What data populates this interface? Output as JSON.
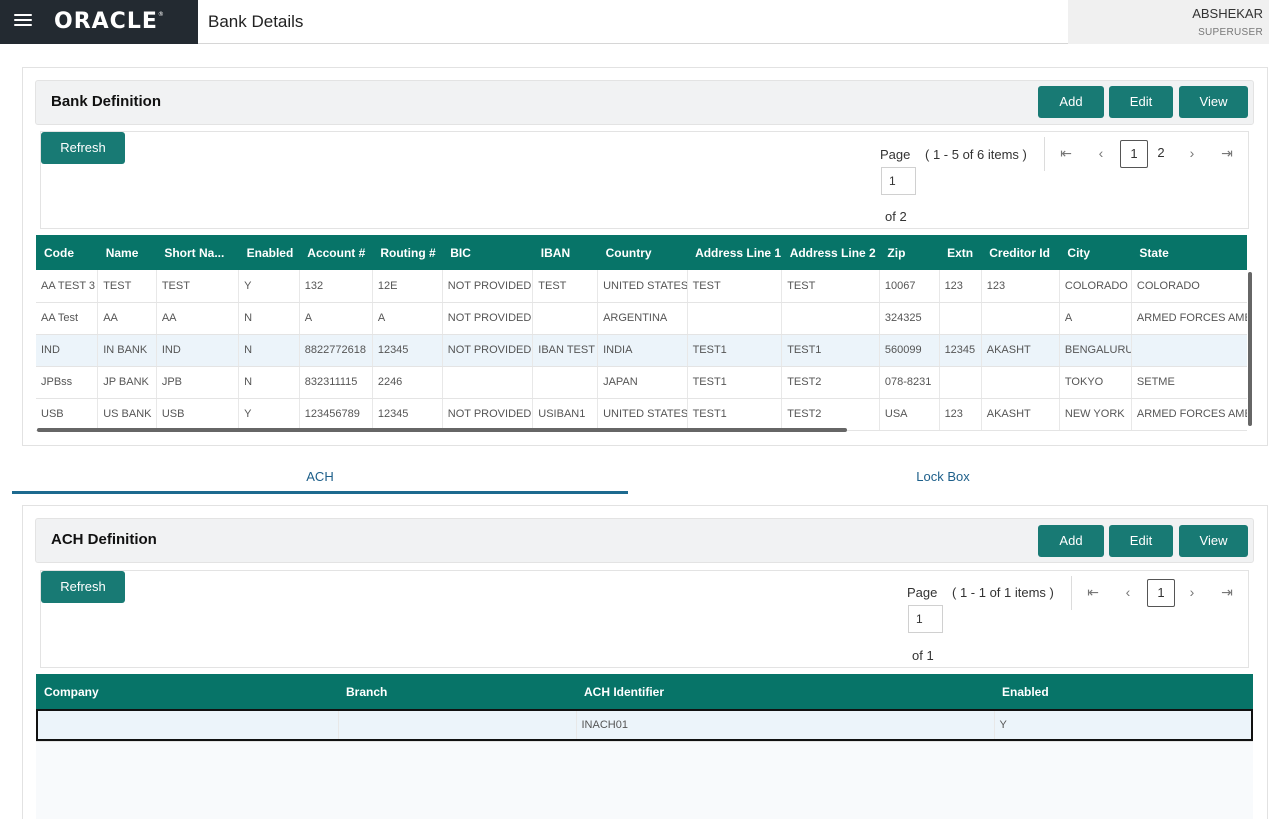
{
  "header": {
    "logo": "ORACLE",
    "title": "Bank Details",
    "user_name": "ABSHEKAR",
    "user_role": "SUPERUSER"
  },
  "bank": {
    "title": "Bank Definition",
    "add_label": "Add",
    "edit_label": "Edit",
    "view_label": "View",
    "refresh_label": "Refresh",
    "pager": {
      "page_label": "Page",
      "range": "( 1 - 5 of 6 items )",
      "page_value": "1",
      "of_label": "of 2",
      "pages": [
        "1",
        "2"
      ]
    },
    "columns": [
      "Code",
      "Name",
      "Short Na...",
      "Enabled",
      "Account #",
      "Routing #",
      "BIC",
      "IBAN",
      "Country",
      "Address Line 1",
      "Address Line 2",
      "Zip",
      "Extn",
      "Creditor Id",
      "City",
      "State"
    ],
    "rows": [
      [
        "AA TEST 3",
        "TEST",
        "TEST",
        "Y",
        "132",
        "12E",
        "NOT PROVIDED",
        "TEST",
        "UNITED STATES",
        "TEST",
        "TEST",
        "10067",
        "123",
        "123",
        "COLORADO",
        "COLORADO"
      ],
      [
        "AA Test",
        "AA",
        "AA",
        "N",
        "A",
        "A",
        "NOT PROVIDED",
        "",
        "ARGENTINA",
        "",
        "",
        "324325",
        "",
        "",
        "A",
        "ARMED FORCES AMERICANS"
      ],
      [
        "IND",
        "IN BANK",
        "IND",
        "N",
        "8822772618",
        "12345",
        "NOT PROVIDED",
        "IBAN TEST",
        "INDIA",
        "TEST1",
        "TEST1",
        "560099",
        "12345",
        "AKASHT",
        "BENGALURU",
        ""
      ],
      [
        "JPBss",
        "JP BANK",
        "JPB",
        "N",
        "832311115",
        "2246",
        "",
        "",
        "JAPAN",
        "TEST1",
        "TEST2",
        "078-8231",
        "",
        "",
        "TOKYO",
        "SETME"
      ],
      [
        "USB",
        "US BANK",
        "USB",
        "Y",
        "123456789",
        "12345",
        "NOT PROVIDED",
        "USIBAN1",
        "UNITED STATES",
        "TEST1",
        "TEST2",
        "USA",
        "123",
        "AKASHT",
        "NEW YORK",
        "ARMED FORCES AMERICANS"
      ]
    ]
  },
  "tabs": {
    "ach": "ACH",
    "lockbox": "Lock Box"
  },
  "ach": {
    "title": "ACH Definition",
    "add_label": "Add",
    "edit_label": "Edit",
    "view_label": "View",
    "refresh_label": "Refresh",
    "pager": {
      "page_label": "Page",
      "range": "( 1 - 1 of 1 items )",
      "page_value": "1",
      "of_label": "of 1",
      "pages": [
        "1"
      ]
    },
    "columns": [
      "Company",
      "Branch",
      "ACH Identifier",
      "Enabled"
    ],
    "rows": [
      [
        "",
        "",
        "INACH01",
        "Y"
      ]
    ]
  }
}
